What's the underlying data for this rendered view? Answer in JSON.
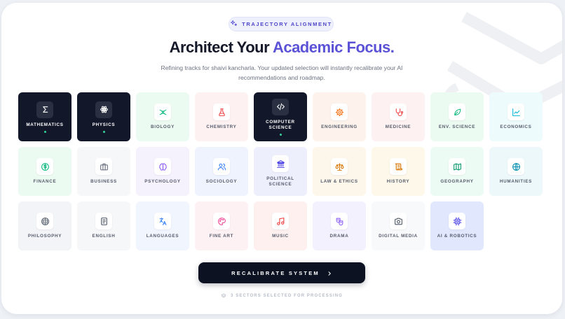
{
  "badge": {
    "label": "TRAJECTORY ALIGNMENT",
    "icon": "sparkles-icon"
  },
  "heading": {
    "prefix": "Architect Your",
    "accent": "Academic Focus."
  },
  "subtitle": "Refining tracks for shaivi kancharla. Your updated selection will instantly recalibrate your AI recommendations and roadmap.",
  "colors": {
    "accent": "#5b52d6",
    "selected_tile": "#121729",
    "selected_dot": "#34d399"
  },
  "tracks": [
    {
      "label": "MATHEMATICS",
      "icon": "sigma-icon",
      "selected": true
    },
    {
      "label": "PHYSICS",
      "icon": "atom-icon",
      "selected": true
    },
    {
      "label": "BIOLOGY",
      "icon": "dna-icon",
      "selected": false
    },
    {
      "label": "CHEMISTRY",
      "icon": "flask-icon",
      "selected": false
    },
    {
      "label": "COMPUTER SCIENCE",
      "icon": "code-icon",
      "selected": true
    },
    {
      "label": "ENGINEERING",
      "icon": "gear-icon",
      "selected": false
    },
    {
      "label": "MEDICINE",
      "icon": "stethoscope-icon",
      "selected": false
    },
    {
      "label": "ENV. SCIENCE",
      "icon": "leaf-icon",
      "selected": false
    },
    {
      "label": "ECONOMICS",
      "icon": "line-chart-icon",
      "selected": false
    },
    {
      "label": "FINANCE",
      "icon": "dollar-icon",
      "selected": false
    },
    {
      "label": "BUSINESS",
      "icon": "briefcase-icon",
      "selected": false
    },
    {
      "label": "PSYCHOLOGY",
      "icon": "brain-icon",
      "selected": false
    },
    {
      "label": "SOCIOLOGY",
      "icon": "users-icon",
      "selected": false
    },
    {
      "label": "POLITICAL SCIENCE",
      "icon": "landmark-icon",
      "selected": false
    },
    {
      "label": "LAW & ETHICS",
      "icon": "scale-icon",
      "selected": false
    },
    {
      "label": "HISTORY",
      "icon": "scroll-icon",
      "selected": false
    },
    {
      "label": "GEOGRAPHY",
      "icon": "map-icon",
      "selected": false
    },
    {
      "label": "HUMANITIES",
      "icon": "globe-icon",
      "selected": false
    },
    {
      "label": "PHILOSOPHY",
      "icon": "brain-circle-icon",
      "selected": false
    },
    {
      "label": "ENGLISH",
      "icon": "document-icon",
      "selected": false
    },
    {
      "label": "LANGUAGES",
      "icon": "translate-icon",
      "selected": false
    },
    {
      "label": "FINE ART",
      "icon": "palette-icon",
      "selected": false
    },
    {
      "label": "MUSIC",
      "icon": "music-note-icon",
      "selected": false
    },
    {
      "label": "DRAMA",
      "icon": "drama-masks-icon",
      "selected": false
    },
    {
      "label": "DIGITAL MEDIA",
      "icon": "camera-icon",
      "selected": false
    },
    {
      "label": "AI & ROBOTICS",
      "icon": "cpu-icon",
      "selected": false
    }
  ],
  "action": {
    "label": "RECALIBRATE SYSTEM",
    "icon": "chevron-right-icon"
  },
  "status": {
    "text": "3 SECTORS SELECTED FOR PROCESSING",
    "icon": "layers-icon"
  }
}
